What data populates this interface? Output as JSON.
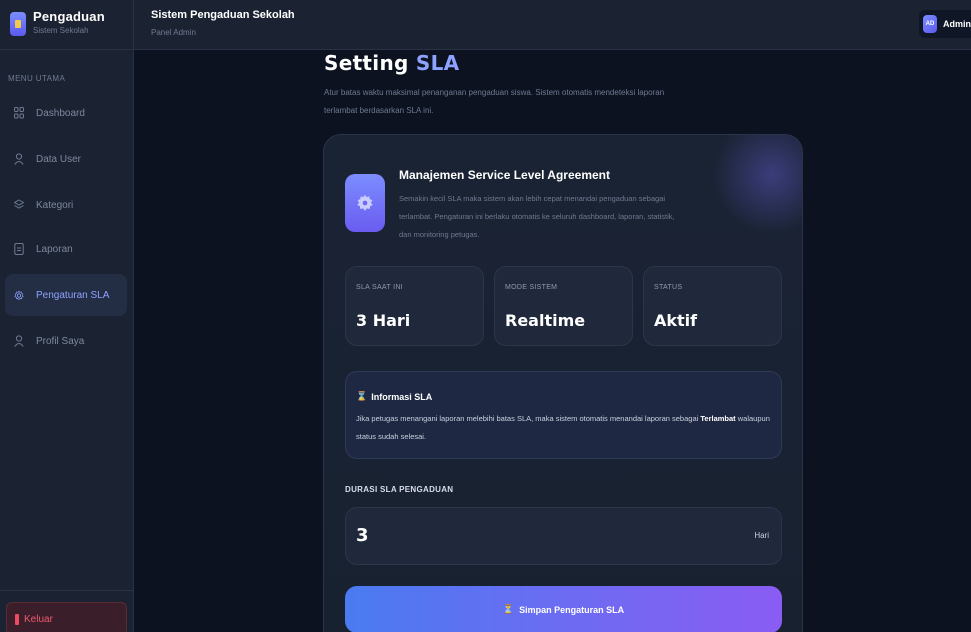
{
  "brand": {
    "title": "Pengaduan",
    "subtitle": "Sistem Sekolah"
  },
  "sidebar": {
    "heading": "MENU UTAMA",
    "items": [
      {
        "label": "Dashboard",
        "icon": "grid-icon"
      },
      {
        "label": "Data User",
        "icon": "user-icon"
      },
      {
        "label": "Kategori",
        "icon": "layers-icon"
      },
      {
        "label": "Laporan",
        "icon": "document-icon"
      },
      {
        "label": "Pengaturan SLA",
        "icon": "gear-icon",
        "active": true
      },
      {
        "label": "Profil Saya",
        "icon": "user-icon"
      }
    ],
    "logout_label": "Keluar"
  },
  "topbar": {
    "title": "Sistem Pengaduan Sekolah",
    "subtitle": "Panel Admin",
    "avatar_initials": "AD",
    "user_name": "Admin"
  },
  "page": {
    "title_part1": "Setting ",
    "title_part2": "SLA",
    "description": "Atur batas waktu maksimal penanganan pengaduan siswa. Sistem otomatis mendeteksi laporan terlambat berdasarkan SLA ini."
  },
  "card": {
    "title": "Manajemen Service Level Agreement",
    "description": "Semakin kecil SLA maka sistem akan lebih cepat menandai pengaduan sebagai terlambat. Pengaturan ini berlaku otomatis ke seluruh dashboard, laporan, statistik, dan monitoring petugas.",
    "stats": [
      {
        "label": "SLA SAAT INI",
        "value": "3 Hari"
      },
      {
        "label": "MODE SISTEM",
        "value": "Realtime"
      },
      {
        "label": "STATUS",
        "value": "Aktif"
      }
    ],
    "info": {
      "title": "Informasi SLA",
      "text_before": "Jika petugas menangani laporan melebihi batas SLA, maka sistem otomatis menandai laporan sebagai ",
      "text_bold": "Terlambat",
      "text_after": " walaupun status sudah selesai."
    },
    "field": {
      "label": "DURASI SLA PENGADUAN",
      "value": "3",
      "unit": "Hari"
    },
    "save_label": "Simpan Pengaturan SLA"
  },
  "colors": {
    "accent": "#8ea2ff",
    "danger": "#ef4a5f",
    "background": "#0c1220",
    "panel": "#1b2333"
  }
}
